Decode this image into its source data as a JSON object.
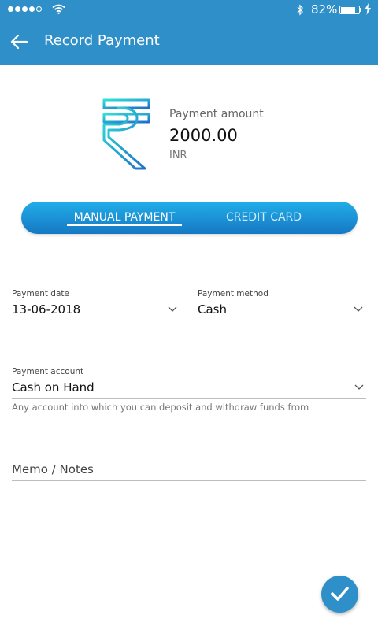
{
  "status_bar": {
    "battery_percent": "82%",
    "battery_level": 0.82
  },
  "header": {
    "title": "Record Payment"
  },
  "amount": {
    "label": "Payment amount",
    "value": "2000.00",
    "currency": "INR"
  },
  "tabs": [
    {
      "label": "MANUAL PAYMENT",
      "selected": true
    },
    {
      "label": "CREDIT CARD",
      "selected": false
    }
  ],
  "form": {
    "payment_date": {
      "label": "Payment date",
      "value": "13-06-2018"
    },
    "payment_method": {
      "label": "Payment method",
      "value": "Cash"
    },
    "payment_account": {
      "label": "Payment account",
      "value": "Cash on Hand",
      "help": "Any account into which you can deposit and withdraw funds from"
    },
    "memo": {
      "placeholder": "Memo / Notes"
    }
  },
  "colors": {
    "primary": "#2f8fc9",
    "tab_gradient_top": "#21aee8",
    "tab_gradient_bottom": "#1678c4"
  },
  "icons": [
    "back-arrow-icon",
    "rupee-icon",
    "chevron-down-icon",
    "check-icon"
  ]
}
